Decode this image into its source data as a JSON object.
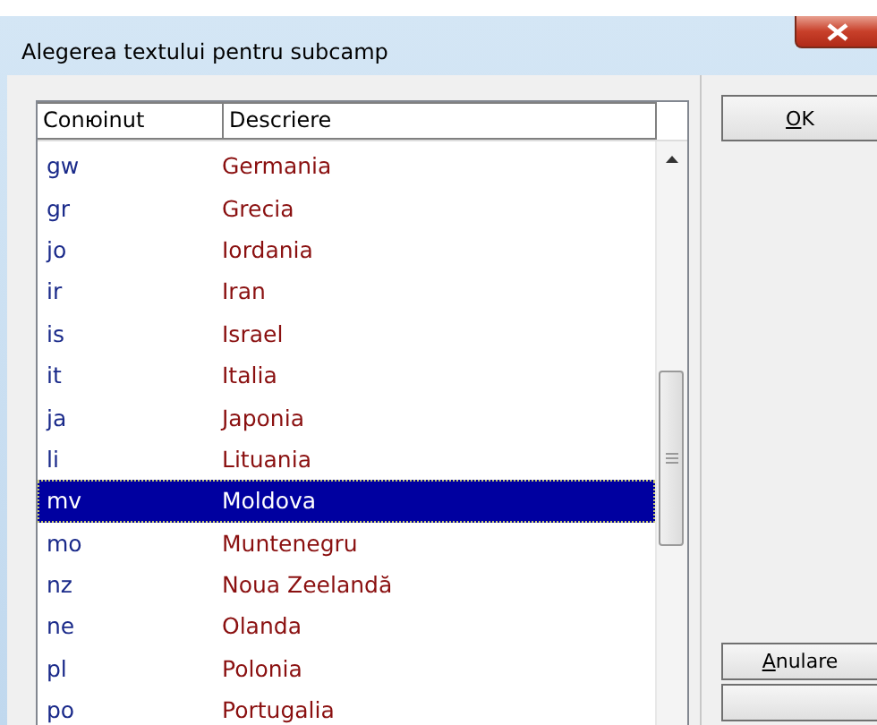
{
  "window": {
    "title": "Alegerea textului pentru subcamp"
  },
  "table": {
    "columns": [
      "Conюinut",
      "Descriere"
    ],
    "rows": [
      {
        "code": "gw",
        "description": "Germania",
        "selected": false
      },
      {
        "code": "gr",
        "description": "Grecia",
        "selected": false
      },
      {
        "code": "jo",
        "description": "Iordania",
        "selected": false
      },
      {
        "code": "ir",
        "description": "Iran",
        "selected": false
      },
      {
        "code": "is",
        "description": "Israel",
        "selected": false
      },
      {
        "code": "it",
        "description": "Italia",
        "selected": false
      },
      {
        "code": "ja",
        "description": "Japonia",
        "selected": false
      },
      {
        "code": "li",
        "description": "Lituania",
        "selected": false
      },
      {
        "code": "mv",
        "description": "Moldova",
        "selected": true
      },
      {
        "code": "mo",
        "description": "Muntenegru",
        "selected": false
      },
      {
        "code": "nz",
        "description": "Noua Zeelandă",
        "selected": false
      },
      {
        "code": "ne",
        "description": "Olanda",
        "selected": false
      },
      {
        "code": "pl",
        "description": "Polonia",
        "selected": false
      },
      {
        "code": "po",
        "description": "Portugalia",
        "selected": false
      }
    ]
  },
  "buttons": [
    {
      "kind": "top",
      "label": "OK",
      "mnemonic_underlined": true
    },
    {
      "kind": "bottom",
      "label": "Anulare",
      "mnemonic_underlined": true
    },
    {
      "kind": "bottom"
    }
  ]
}
